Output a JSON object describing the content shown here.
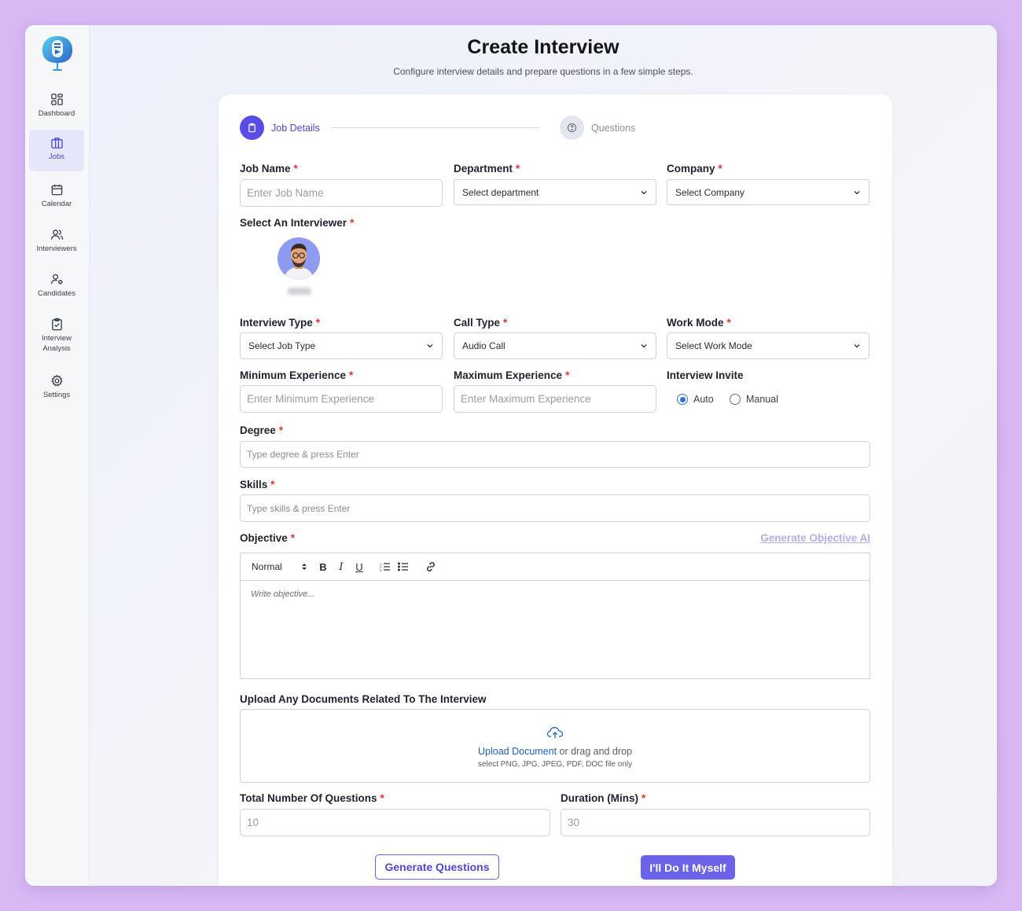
{
  "sidebar": {
    "items": [
      {
        "label": "Dashboard",
        "icon": "dashboard-icon"
      },
      {
        "label": "Jobs",
        "icon": "briefcase-icon",
        "active": true
      },
      {
        "label": "Calendar",
        "icon": "calendar-icon"
      },
      {
        "label": "Interviewers",
        "icon": "users-icon"
      },
      {
        "label": "Candidates",
        "icon": "user-gear-icon"
      },
      {
        "label": "Interview Analysis",
        "icon": "clipboard-check-icon"
      },
      {
        "label": "Settings",
        "icon": "gear-icon"
      }
    ]
  },
  "header": {
    "title": "Create Interview",
    "subtitle": "Configure interview details and prepare questions in a few simple steps."
  },
  "steps": [
    {
      "label": "Job Details",
      "state": "active"
    },
    {
      "label": "Questions",
      "state": "inactive"
    }
  ],
  "form": {
    "job_name": {
      "label": "Job Name",
      "placeholder": "Enter Job Name"
    },
    "department": {
      "label": "Department",
      "value": "Select department"
    },
    "company": {
      "label": "Company",
      "value": "Select Company"
    },
    "interviewer": {
      "label": "Select An Interviewer"
    },
    "interview_type": {
      "label": "Interview Type",
      "value": "Select Job Type"
    },
    "call_type": {
      "label": "Call Type",
      "value": "Audio Call"
    },
    "work_mode": {
      "label": "Work Mode",
      "value": "Select Work Mode"
    },
    "min_exp": {
      "label": "Minimum Experience",
      "placeholder": "Enter Minimum Experience"
    },
    "max_exp": {
      "label": "Maximum Experience",
      "placeholder": "Enter Maximum Experience"
    },
    "invite": {
      "label": "Interview Invite",
      "options": [
        "Auto",
        "Manual"
      ],
      "selected": "Auto"
    },
    "degree": {
      "label": "Degree",
      "placeholder": "Type degree & press Enter"
    },
    "skills": {
      "label": "Skills",
      "placeholder": "Type skills & press Enter"
    },
    "objective": {
      "label": "Objective",
      "ai_link": "Generate Objective AI",
      "format_value": "Normal",
      "placeholder": "Write objective..."
    },
    "upload": {
      "label": "Upload Any Documents Related To The Interview",
      "link": "Upload Document",
      "rest": " or drag and drop",
      "hint": "select PNG, JPG, JPEG, PDF, DOC file only"
    },
    "total_questions": {
      "label": "Total Number Of Questions",
      "value": "10"
    },
    "duration": {
      "label": "Duration (Mins)",
      "value": "30"
    }
  },
  "buttons": {
    "generate": "Generate Questions",
    "myself": "I'll Do It Myself"
  },
  "colors": {
    "accent": "#5a4de6",
    "button": "#6a62e8",
    "required": "#e0362c",
    "background": "#d9b9f3"
  }
}
